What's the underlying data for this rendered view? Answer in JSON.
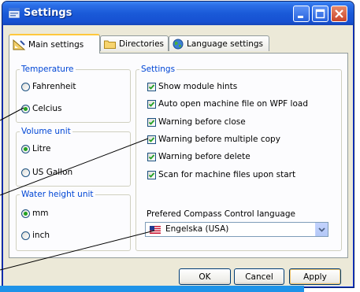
{
  "window": {
    "title": "Settings"
  },
  "tabs": [
    {
      "label": "Main settings",
      "icon": "ruler-icon",
      "active": true
    },
    {
      "label": "Directories",
      "icon": "folder-icon",
      "active": false
    },
    {
      "label": "Language settings",
      "icon": "globe-icon",
      "active": false
    }
  ],
  "temperature": {
    "legend": "Temperature",
    "options": [
      {
        "label": "Fahrenheit",
        "selected": false
      },
      {
        "label": "Celcius",
        "selected": true
      }
    ]
  },
  "volume": {
    "legend": "Volume unit",
    "options": [
      {
        "label": "Litre",
        "selected": true
      },
      {
        "label": "US Gallon",
        "selected": false
      }
    ]
  },
  "water": {
    "legend": "Water height unit",
    "options": [
      {
        "label": "mm",
        "selected": true
      },
      {
        "label": "inch",
        "selected": false
      }
    ]
  },
  "settings": {
    "legend": "Settings",
    "checks": [
      {
        "label": "Show module hints",
        "checked": true
      },
      {
        "label": "Auto open machine file on WPF load",
        "checked": true
      },
      {
        "label": "Warning before close",
        "checked": true
      },
      {
        "label": "Warning before multiple copy",
        "checked": true
      },
      {
        "label": "Warning before delete",
        "checked": true
      },
      {
        "label": "Scan for machine files upon start",
        "checked": true
      }
    ],
    "language_label": "Prefered Compass Control language",
    "language_value": "Engelska (USA)",
    "language_flag": "us-flag-icon"
  },
  "buttons": {
    "ok": "OK",
    "cancel": "Cancel",
    "apply": "Apply"
  },
  "colors": {
    "title_bar": "#2c6fe8",
    "legend_text": "#0046d5",
    "caption_band": "#1e93e8",
    "check_mark": "#21a121"
  }
}
